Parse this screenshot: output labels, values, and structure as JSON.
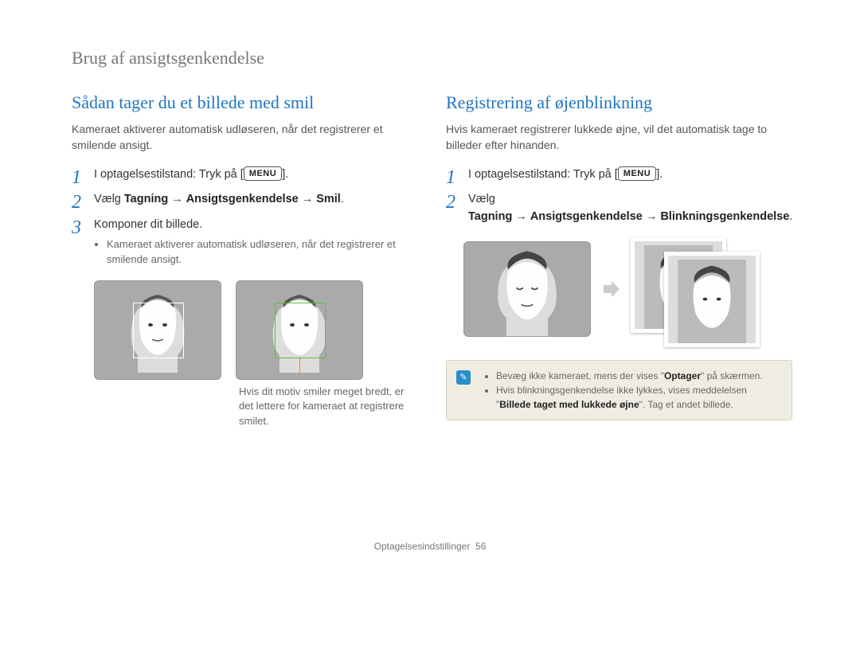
{
  "breadcrumb": "Brug af ansigtsgenkendelse",
  "left": {
    "title": "Sådan tager du et billede med smil",
    "intro": "Kameraet aktiverer automatisk udløseren, når det registrerer et smilende ansigt.",
    "step1_pre": "I optagelsestilstand: Tryk på [",
    "step1_chip": "MENU",
    "step1_post": "].",
    "step2_pre": "Vælg ",
    "step2_b1": "Tagning",
    "step2_b2": "Ansigtsgenkendelse",
    "step2_b3": "Smil",
    "step2_post": ".",
    "step3": "Komponer dit billede.",
    "step3_bullet": "Kameraet aktiverer automatisk udløseren, når det registrerer et smilende ansigt.",
    "caption": "Hvis dit motiv smiler meget bredt, er det lettere for kameraet at registrere smilet."
  },
  "right": {
    "title": "Registrering af øjenblinkning",
    "intro": "Hvis kameraet registrerer lukkede øjne, vil det automatisk tage to billeder efter hinanden.",
    "step1_pre": "I optagelsestilstand: Tryk på [",
    "step1_chip": "MENU",
    "step1_post": "].",
    "step2_pre": "Vælg ",
    "step2_b1": "Tagning",
    "step2_b2": "Ansigtsgenkendelse",
    "step2_b3": "Blinkningsgenkendelse",
    "step2_post": ".",
    "note1_pre": "Bevæg ikke kameraet, mens der vises \"",
    "note1_bold": "Optager",
    "note1_post": "\" på skærmen.",
    "note2_pre": "Hvis blinkningsgenkendelse ikke lykkes, vises meddelelsen \"",
    "note2_bold": "Billede taget med lukkede øjne",
    "note2_post": "\". Tag et andet billede."
  },
  "footer_section": "Optagelsesindstillinger",
  "footer_page": "56",
  "arrow_glyph": "→"
}
